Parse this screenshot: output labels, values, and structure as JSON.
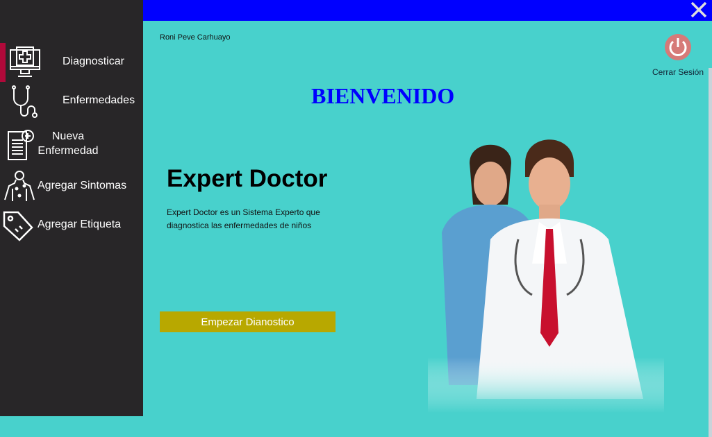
{
  "sidebar": {
    "items": [
      {
        "label": "Diagnosticar",
        "icon": "monitor-medical-icon",
        "active": true
      },
      {
        "label": "Enfermedades",
        "icon": "stethoscope-icon"
      },
      {
        "label": "Nueva Enfermedad",
        "icon": "document-plus-icon"
      },
      {
        "label": "Agregar Sintomas",
        "icon": "body-icon"
      },
      {
        "label": "Agregar Etiqueta",
        "icon": "tag-icon"
      }
    ]
  },
  "header": {
    "close_icon": "close-icon",
    "user": "Roni Peve Carhuayo",
    "logout_label": "Cerrar Sesión"
  },
  "main": {
    "welcome": "BIENVENIDO",
    "title": "Expert Doctor",
    "description": "Expert Doctor es un Sistema Experto que diagnostica las enfermedades de niños",
    "start_label": "Empezar Dianostico"
  },
  "colors": {
    "sidebar": "#282628",
    "accent": "#b0093a",
    "topbar": "#0000ff",
    "background": "#48d1cc",
    "button": "#b8a800"
  }
}
